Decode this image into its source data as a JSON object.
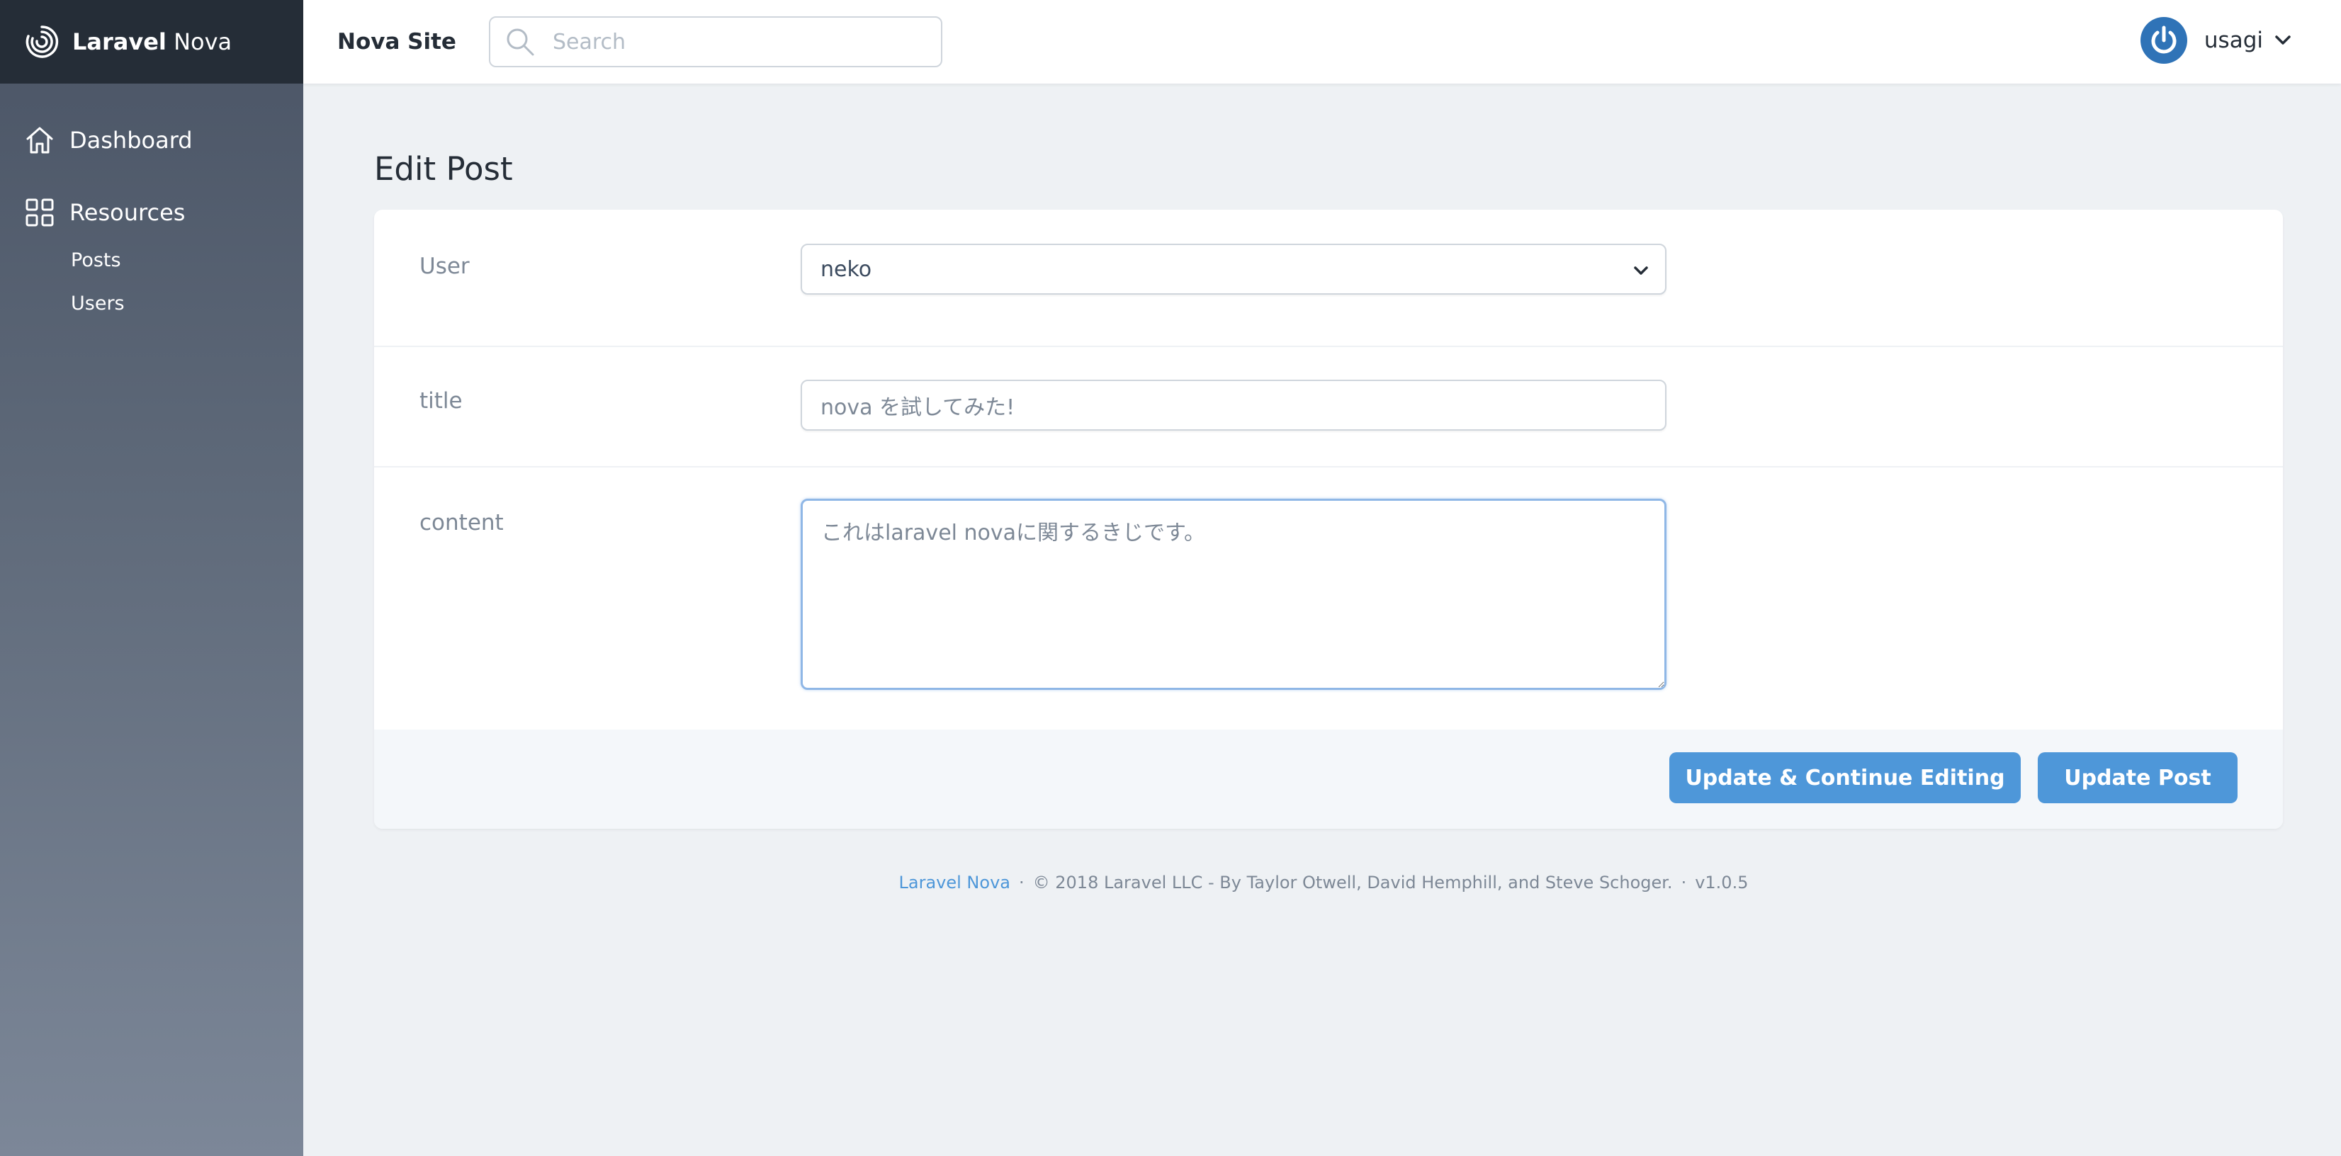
{
  "brand": {
    "bold": "Laravel",
    "light": "Nova"
  },
  "sidebar": {
    "dashboard_label": "Dashboard",
    "resources_label": "Resources",
    "resources": [
      {
        "label": "Posts"
      },
      {
        "label": "Users"
      }
    ]
  },
  "header": {
    "site_name": "Nova Site",
    "search_placeholder": "Search",
    "username": "usagi"
  },
  "page": {
    "title": "Edit Post"
  },
  "form": {
    "user": {
      "label": "User",
      "value": "neko"
    },
    "title": {
      "label": "title",
      "value": "nova を試してみた!"
    },
    "content": {
      "label": "content",
      "value": "これはlaravel novaに関するきじです。"
    }
  },
  "actions": {
    "continue_label": "Update & Continue Editing",
    "update_label": "Update Post"
  },
  "footer": {
    "link": "Laravel Nova",
    "sep1": "·",
    "copyright": "© 2018 Laravel LLC - By Taylor Otwell, David Hemphill, and Steve Schoger.",
    "sep2": "·",
    "version": "v1.0.5"
  },
  "colors": {
    "primary": "#4e97d9",
    "sidebar_top": "#252d37",
    "avatar": "#2f73b7",
    "background": "#eef1f4"
  }
}
